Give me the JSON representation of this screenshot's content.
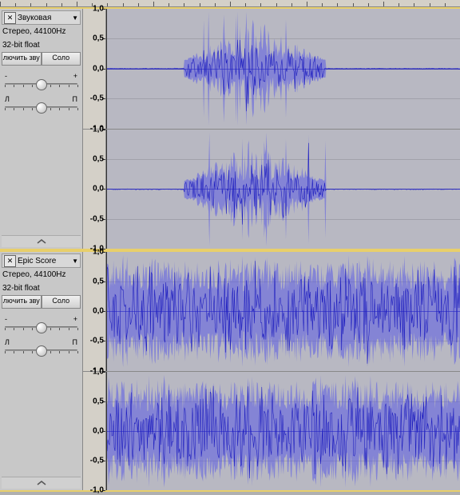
{
  "timeline": {
    "ticks": 30
  },
  "tracks": [
    {
      "title": "Звуковая",
      "format": "Стерео, 44100Hz",
      "bitdepth": "32-bit float",
      "button_mute": "лючить зву",
      "button_solo": "Соло",
      "gain": {
        "left": "-",
        "right": "+",
        "value": 0.5
      },
      "pan": {
        "left": "Л",
        "right": "П",
        "value": 0.5
      },
      "waveform_type": "sparse",
      "axis": [
        "1,0",
        "0,5",
        "0,0",
        "-0,5",
        "-1,0"
      ]
    },
    {
      "title": "Epic Score",
      "format": "Стерео, 44100Hz",
      "bitdepth": "32-bit float",
      "button_mute": "лючить зву",
      "button_solo": "Соло",
      "gain": {
        "left": "-",
        "right": "+",
        "value": 0.5
      },
      "pan": {
        "left": "Л",
        "right": "П",
        "value": 0.5
      },
      "waveform_type": "dense",
      "axis": [
        "1,0",
        "0,5",
        "0,0",
        "-0,5",
        "-1,0"
      ]
    }
  ]
}
